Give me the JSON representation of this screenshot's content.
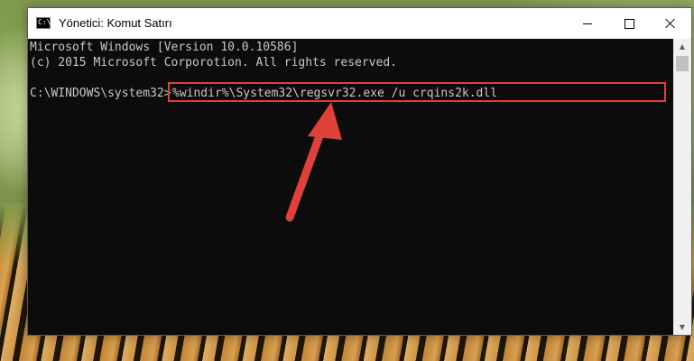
{
  "window": {
    "title": "Yönetici: Komut Satırı",
    "icon": "cmd-icon",
    "icon_glyph": "C:\\"
  },
  "controls": {
    "minimize": "minimize-icon",
    "maximize": "maximize-icon",
    "close": "close-icon"
  },
  "console": {
    "line1": "Microsoft Windows [Version 10.0.10586]",
    "line2": "(c) 2015 Microsoft Corporotion. All rights reserved.",
    "prompt": "C:\\WINDOWS\\system32>",
    "command": "%windir%\\System32\\regsvr32.exe /u crqins2k.dll"
  },
  "annotation": {
    "highlight_color": "#e0403a",
    "arrow_color": "#e0403a"
  },
  "scrollbar": {
    "up_glyph": "▲",
    "down_glyph": "▼"
  }
}
